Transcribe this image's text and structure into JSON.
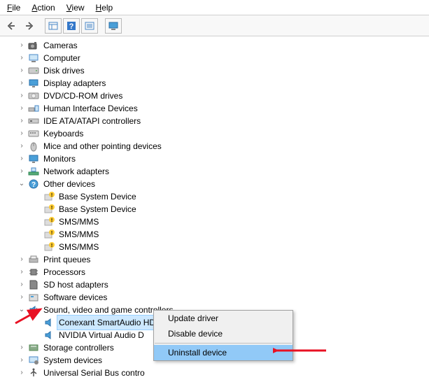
{
  "menu": {
    "file": "File",
    "action": "Action",
    "view": "View",
    "help": "Help"
  },
  "tree": {
    "cameras": "Cameras",
    "computer": "Computer",
    "disk_drives": "Disk drives",
    "display_adapters": "Display adapters",
    "dvd": "DVD/CD-ROM drives",
    "hid": "Human Interface Devices",
    "ide": "IDE ATA/ATAPI controllers",
    "keyboards": "Keyboards",
    "mice": "Mice and other pointing devices",
    "monitors": "Monitors",
    "network": "Network adapters",
    "other": "Other devices",
    "other_children": {
      "bsd1": "Base System Device",
      "bsd2": "Base System Device",
      "sms1": "SMS/MMS",
      "sms2": "SMS/MMS",
      "sms3": "SMS/MMS"
    },
    "print_queues": "Print queues",
    "processors": "Processors",
    "sd_host": "SD host adapters",
    "software_devices": "Software devices",
    "sound": "Sound, video and game controllers",
    "sound_children": {
      "conexant": "Conexant SmartAudio HD",
      "nvidia": "NVIDIA Virtual Audio D"
    },
    "storage": "Storage controllers",
    "system": "System devices",
    "usb": "Universal Serial Bus contro"
  },
  "context": {
    "update": "Update driver",
    "disable": "Disable device",
    "uninstall": "Uninstall device"
  },
  "arrows": {
    "collapsed": "›",
    "expanded": "⌄"
  }
}
